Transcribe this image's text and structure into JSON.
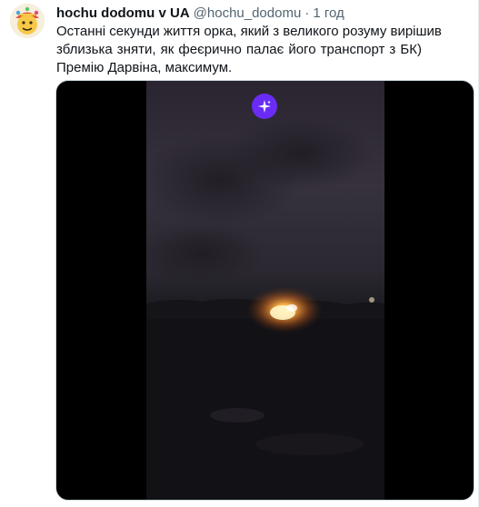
{
  "tweet": {
    "author_name": "hochu dodomu v UA",
    "author_handle": "@hochu_dodomu",
    "separator": "·",
    "time": "1 год",
    "text_lines": [
      "Останні секунди життя орка, який з великого розуму вирішив",
      "зблизька зняти, як феєрично палає його транспорт з БК)",
      "Премію Дарвіна, максимум."
    ]
  },
  "icons": {
    "avatar": "avatar-emoji-icon",
    "media_badge": "sparkle-icon"
  },
  "colors": {
    "name": "#0f1419",
    "secondary": "#536471",
    "badge": "#6a2cf5",
    "fire": "#ff9a2e"
  }
}
